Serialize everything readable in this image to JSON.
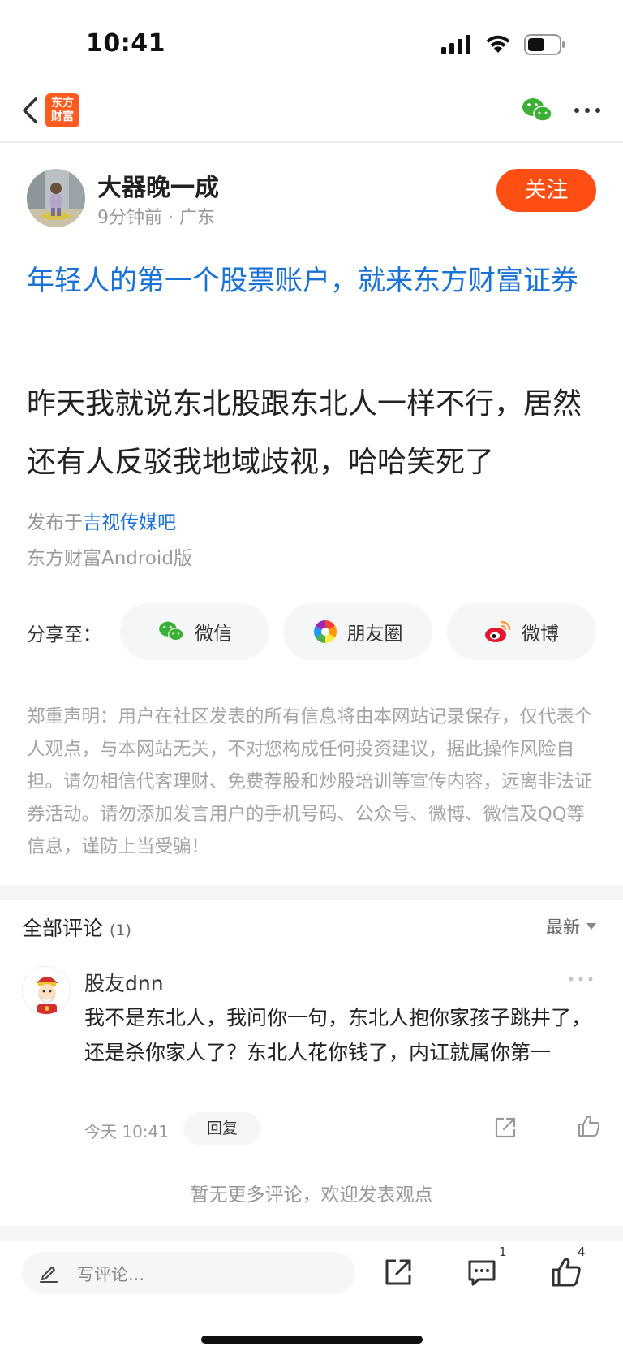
{
  "status_bar": {
    "time": "10:41"
  },
  "nav": {
    "logo_line1": "东方",
    "logo_line2": "财富"
  },
  "author": {
    "name": "大器晚一成",
    "time": "9分钟前",
    "location": "广东",
    "follow_label": "关注"
  },
  "post": {
    "ad_title": "年轻人的第一个股票账户，就来东方财富证券",
    "body": "昨天我就说东北股跟东北人一样不行，居然还有人反驳我地域歧视，哈哈笑死了",
    "published_prefix": "发布于",
    "forum": "吉视传媒吧",
    "client": "东方财富Android版"
  },
  "share": {
    "label": "分享至：",
    "wechat": "微信",
    "moments": "朋友圈",
    "weibo": "微博"
  },
  "disclaimer": "郑重声明：用户在社区发表的所有信息将由本网站记录保存，仅代表个人观点，与本网站无关，不对您构成任何投资建议，据此操作风险自担。请勿相信代客理财、免费荐股和炒股培训等宣传内容，远离非法证券活动。请勿添加发言用户的手机号码、公众号、微博、微信及QQ等信息，谨防上当受骗！",
  "comments": {
    "title": "全部评论",
    "count": "(1)",
    "sort_label": "最新",
    "items": [
      {
        "name": "股友dnn",
        "text": "我不是东北人，我问你一句，东北人抱你家孩子跳井了，还是杀你家人了？东北人花你钱了，内讧就属你第一",
        "time": "今天 10:41",
        "reply_label": "回复"
      }
    ],
    "no_more": "暂无更多评论，欢迎发表观点"
  },
  "bottom_bar": {
    "placeholder": "写评论...",
    "comment_count": "1",
    "like_count": "4"
  },
  "colors": {
    "accent": "#ff4e14",
    "link": "#1872d8",
    "wechat_green": "#3cb034"
  }
}
